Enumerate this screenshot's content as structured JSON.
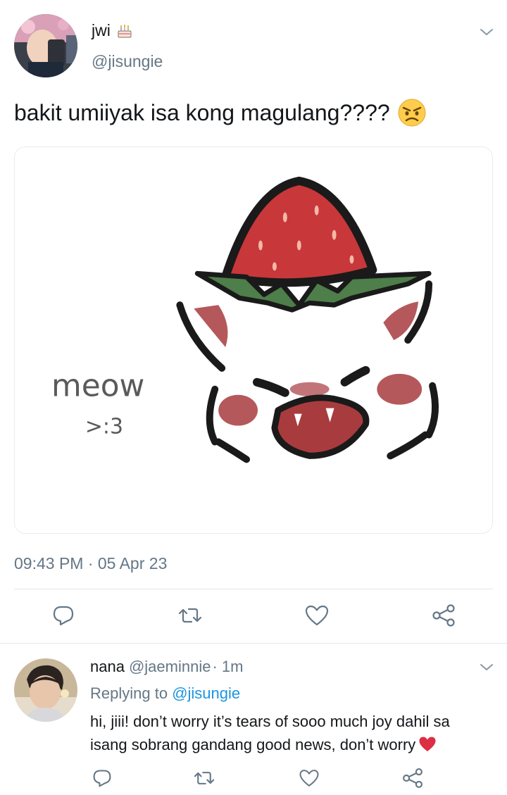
{
  "tweet": {
    "author_name": "jwi",
    "author_handle": "@jisungie",
    "text": "bakit umiiyak isa kong magulang????",
    "timestamp": "09:43 PM · 05 Apr 23",
    "emoji_icons": [
      "birthday-cake-icon",
      "angry-face-icon"
    ],
    "image_text": [
      "meow",
      ">:3"
    ]
  },
  "actions": [
    "reply-icon",
    "retweet-icon",
    "like-icon",
    "share-icon"
  ],
  "reply": {
    "author_name": "nana",
    "author_handle": "@jaeminnie",
    "time": "· 1m",
    "replying_prefix": "Replying to",
    "replying_to": "@jisungie",
    "text": "hi, jiii! don’t worry it’s tears of sooo much joy dahil sa isang sobrang gandang good news, don’t worry",
    "emoji_icon": "red-heart-icon"
  },
  "colors": {
    "text": "#14171a",
    "secondary": "#657786",
    "link": "#1b95e0",
    "divider": "#e1e8ed",
    "icon": "#657786"
  }
}
